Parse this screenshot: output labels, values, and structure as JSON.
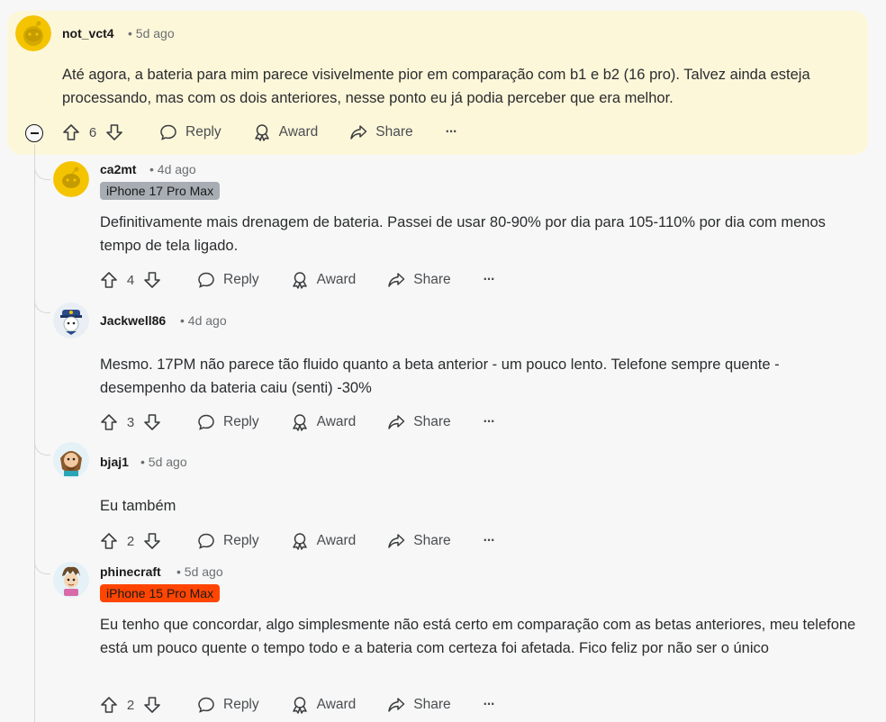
{
  "comments": [
    {
      "author": "not_vct4",
      "time": "• 5d ago",
      "body": "Até agora, a bateria para mim parece visivelmente pior em comparação com b1 e b2 (16 pro). Talvez ainda esteja processando, mas com os dois anteriores, nesse ponto eu já podia perceber que era melhor.",
      "votes": "6",
      "reply_label": "Reply",
      "award_label": "Award",
      "share_label": "Share",
      "more_label": "···"
    },
    {
      "author": "ca2mt",
      "time": "• 4d ago",
      "flair": "iPhone 17 Pro Max",
      "flair_color": "#a7adb3",
      "body": "Definitivamente mais drenagem de bateria. Passei de usar 80-90% por dia para 105-110% por dia com menos tempo de tela ligado.",
      "votes": "4",
      "reply_label": "Reply",
      "award_label": "Award",
      "share_label": "Share",
      "more_label": "···"
    },
    {
      "author": "Jackwell86",
      "time": "• 4d ago",
      "body": "Mesmo. 17PM não parece tão fluido quanto a beta anterior - um pouco lento. Telefone sempre quente - desempenho da bateria caiu (senti) -30%",
      "votes": "3",
      "reply_label": "Reply",
      "award_label": "Award",
      "share_label": "Share",
      "more_label": "···"
    },
    {
      "author": "bjaj1",
      "time": "• 5d ago",
      "body": "Eu também",
      "votes": "2",
      "reply_label": "Reply",
      "award_label": "Award",
      "share_label": "Share",
      "more_label": "···"
    },
    {
      "author": "phinecraft",
      "time": "• 5d ago",
      "flair": "iPhone 15 Pro Max",
      "flair_color": "#ff4500",
      "body": "Eu tenho que concordar, algo simplesmente não está certo em comparação com as betas anteriores, meu telefone está um pouco quente o tempo todo e a bateria com certeza foi afetada. Fico feliz por não ser o único",
      "votes": "2",
      "reply_label": "Reply",
      "award_label": "Award",
      "share_label": "Share",
      "more_label": "···"
    }
  ],
  "colors": {
    "highlight_bg": "#fdf7da",
    "page_bg": "#f7f7f7",
    "flair_gray": "#a7adb3",
    "flair_orange": "#ff4500"
  }
}
